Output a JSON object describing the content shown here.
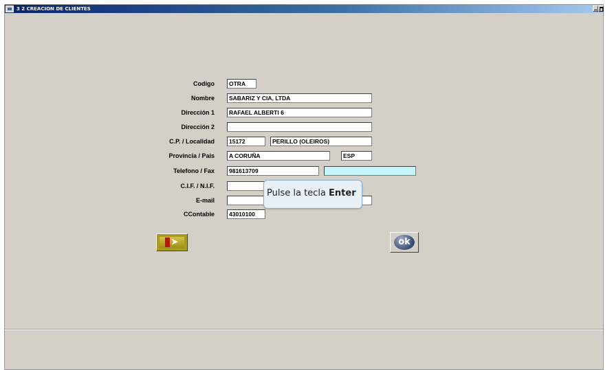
{
  "window": {
    "title": "3 2  CREACION DE CLIENTES"
  },
  "form": {
    "codigo": {
      "label": "Codigo",
      "value": "OTRA"
    },
    "nombre": {
      "label": "Nombre",
      "value": "SABARIZ Y CIA, LTDA"
    },
    "direccion1": {
      "label": "Dirección 1",
      "value": "RAFAEL ALBERTI 6"
    },
    "direccion2": {
      "label": "Dirección 2",
      "value": ""
    },
    "cp": {
      "label": "C.P. / Localidad",
      "value": "15172",
      "localidad": "PERILLO (OLEIROS)"
    },
    "provincia": {
      "label": "Provincia / Pais",
      "value": "A CORUÑA",
      "pais": "ESP"
    },
    "telefono": {
      "label": "Telefono / Fax",
      "value": "981613709",
      "fax": ""
    },
    "cif": {
      "label": "C.I.F. / N.I.F.",
      "value": ""
    },
    "email": {
      "label": "E-mail",
      "value": ""
    },
    "ccontable": {
      "label": "CContable",
      "value": "43010100"
    }
  },
  "tooltip": {
    "text": "Pulse la tecla ",
    "key": "Enter"
  },
  "buttons": {
    "exit_icon": "exit-door-icon",
    "ok_label": "ok"
  },
  "colors": {
    "titlebar": "#0a246a",
    "background": "#d4d0c8",
    "fax_field": "#c4f4fc",
    "exit_button": "#a89c20"
  }
}
